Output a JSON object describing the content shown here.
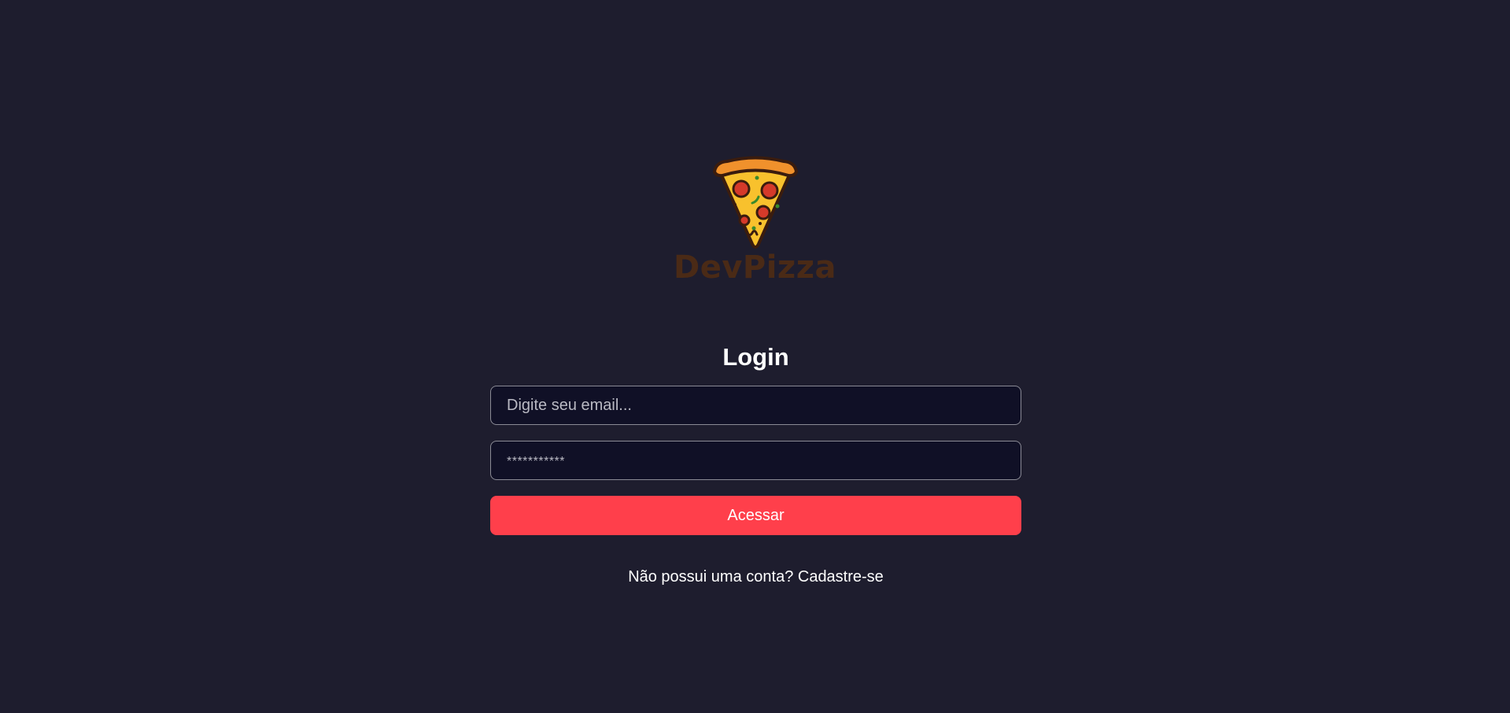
{
  "brand": {
    "name": "DevPizza",
    "logo_icon": "pizza-slice-icon",
    "name_color": "#4a2a16"
  },
  "login": {
    "title": "Login",
    "email_placeholder": "Digite seu email...",
    "password_placeholder": "***********",
    "submit_label": "Acessar",
    "signup_link": "Não possui uma conta? Cadastre-se"
  },
  "colors": {
    "background": "#1e1d2e",
    "input_background": "#101026",
    "input_border": "#8a8a95",
    "accent": "#ff3f4b",
    "text": "#ffffff"
  }
}
